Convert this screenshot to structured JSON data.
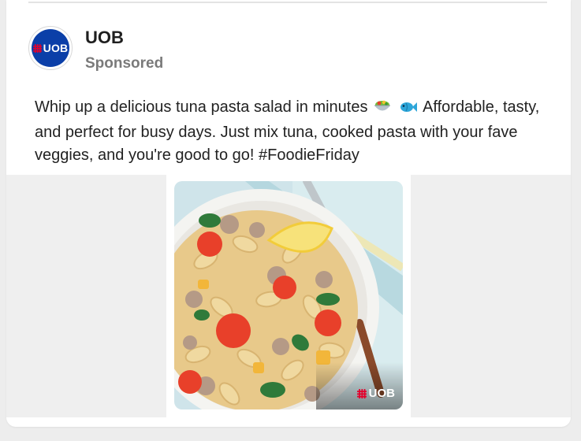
{
  "post": {
    "author": "UOB",
    "label": "Sponsored",
    "text_part1": "Whip up a delicious tuna pasta salad in minutes",
    "text_part2": "Affordable, tasty, and perfect for busy days. Just mix tuna, cooked pasta with your fave veggies, and you're good to go! #FoodieFriday",
    "emojis": [
      "salad-bowl-icon",
      "fish-icon"
    ]
  },
  "brand": {
    "logo_text": "UOB",
    "watermark_text": "UOB",
    "colors": {
      "brand_blue": "#0b3fa8",
      "brand_red": "#e4002b"
    }
  },
  "media": {
    "subject": "tuna-pasta-salad-photo"
  }
}
